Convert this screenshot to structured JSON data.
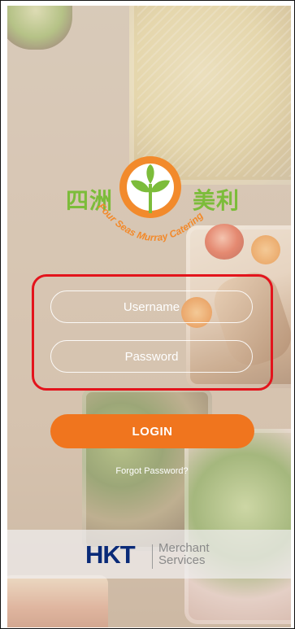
{
  "logo": {
    "cn_left": "四洲",
    "cn_right": "美利",
    "arc_text": "Four Seas Murray Catering"
  },
  "login": {
    "username_placeholder": "Username",
    "password_placeholder": "Password",
    "button_label": "LOGIN",
    "forgot_label": "Forgot Password?"
  },
  "footer": {
    "brand": "HKT",
    "sub_line1": "Merchant",
    "sub_line2": "Services"
  },
  "colors": {
    "accent_orange": "#f0751e",
    "logo_green": "#7cbc3a",
    "highlight_red": "#e3141c",
    "hkt_navy": "#0a2a78"
  }
}
